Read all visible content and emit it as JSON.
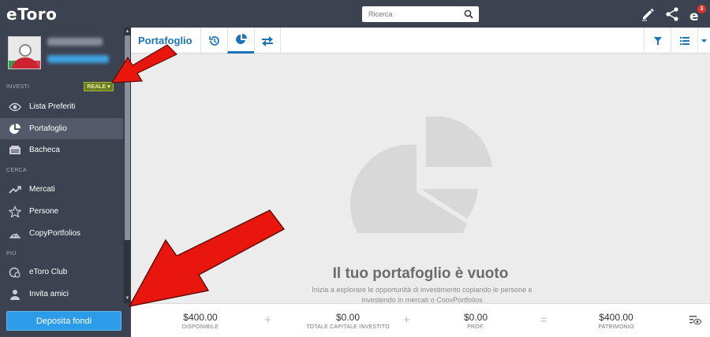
{
  "app": {
    "logo": "eToro"
  },
  "sidebar": {
    "sections": {
      "investi": "INVESTI",
      "cerca": "CERCA",
      "piu": "PIÙ"
    },
    "account_mode": "REALE",
    "items": [
      {
        "label": "Lista Preferiti",
        "icon": "eye-icon"
      },
      {
        "label": "Portafoglio",
        "icon": "pie-chart-icon"
      },
      {
        "label": "Bacheca",
        "icon": "newsfeed-icon"
      },
      {
        "label": "Mercati",
        "icon": "trend-icon"
      },
      {
        "label": "Persone",
        "icon": "star-icon"
      },
      {
        "label": "CopyPortfolios",
        "icon": "copyportfolio-icon"
      },
      {
        "label": "eToro Club",
        "icon": "club-icon"
      },
      {
        "label": "Invita amici",
        "icon": "invite-icon"
      }
    ],
    "deposit_label": "Deposita fondi"
  },
  "topbar": {
    "search_placeholder": "Ricerca",
    "notification_count": "3"
  },
  "portfolio": {
    "title": "Portafoglio",
    "empty_title": "Il tuo portafoglio è vuoto",
    "empty_desc": "Inizia a esplorare le opportunità di investimento copiando le persone e investendo in mercati o CopyPortfolios"
  },
  "footer": {
    "stats": [
      {
        "value": "$400.00",
        "label": "DISPONIBILE"
      },
      {
        "value": "$0.00",
        "label": "TOTALE CAPITALE INVESTITO"
      },
      {
        "value": "$0.00",
        "label": "PROF."
      },
      {
        "value": "$400.00",
        "label": "PATRIMONIO"
      }
    ],
    "operators": [
      "+",
      "+",
      "="
    ]
  },
  "colors": {
    "sidebar_bg": "#3d4250",
    "accent_blue": "#1b74b8",
    "deposit_blue": "#2c9be8",
    "annotation_red": "#e8160c"
  }
}
